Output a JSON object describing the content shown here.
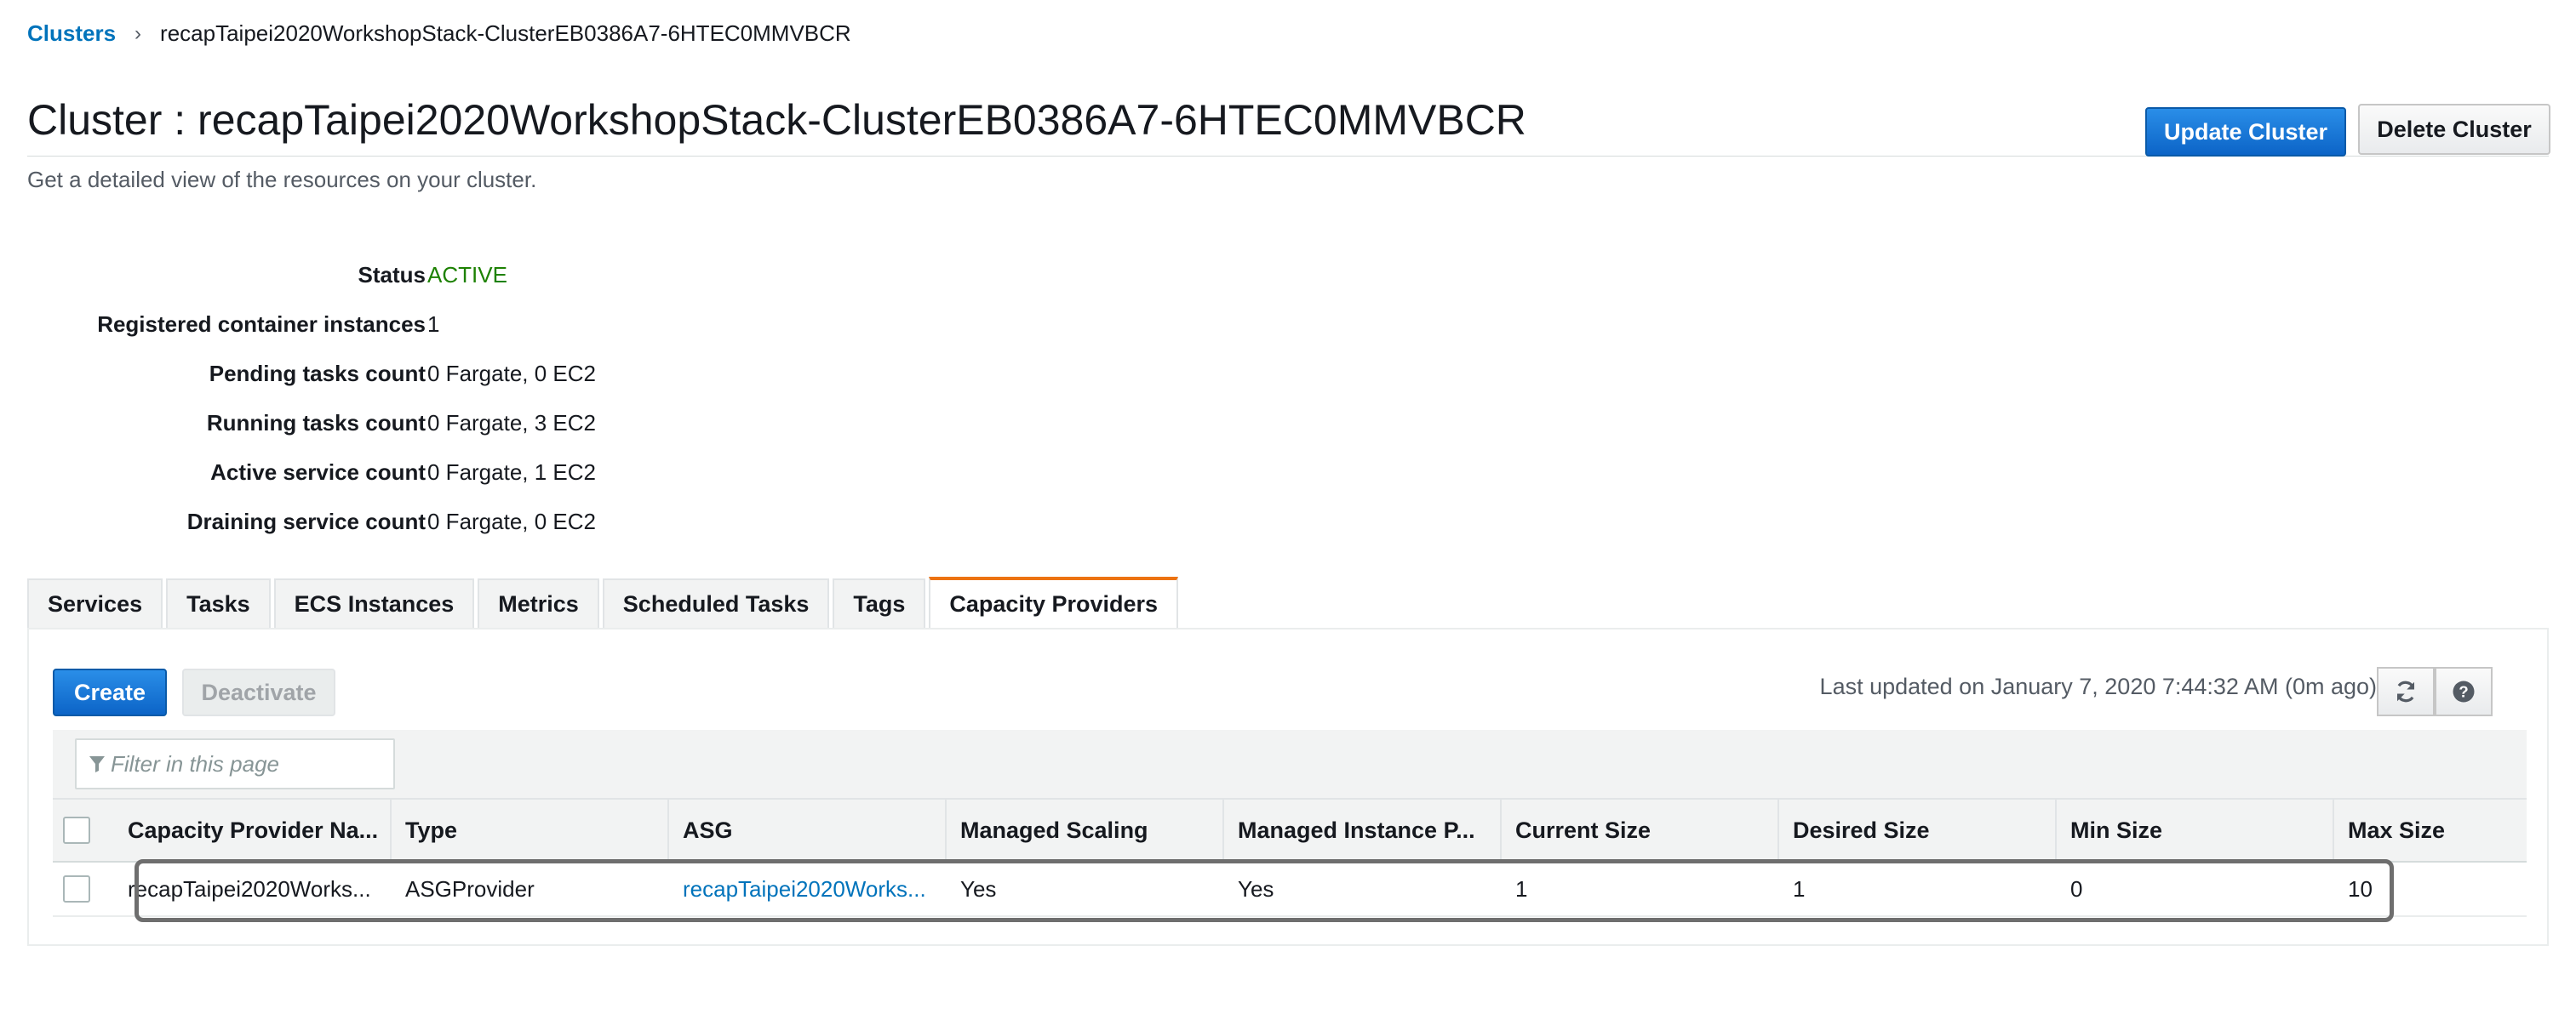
{
  "breadcrumb": {
    "parent": "Clusters",
    "current": "recapTaipei2020WorkshopStack-ClusterEB0386A7-6HTEC0MMVBCR"
  },
  "header": {
    "title": "Cluster : recapTaipei2020WorkshopStack-ClusterEB0386A7-6HTEC0MMVBCR",
    "subtitle": "Get a detailed view of the resources on your cluster.",
    "update_label": "Update Cluster",
    "delete_label": "Delete Cluster"
  },
  "details": [
    {
      "label": "Status",
      "value": "ACTIVE"
    },
    {
      "label": "Registered container instances",
      "value": "1"
    },
    {
      "label": "Pending tasks count",
      "value": "0 Fargate, 0 EC2"
    },
    {
      "label": "Running tasks count",
      "value": "0 Fargate, 3 EC2"
    },
    {
      "label": "Active service count",
      "value": "0 Fargate, 1 EC2"
    },
    {
      "label": "Draining service count",
      "value": "0 Fargate, 0 EC2"
    }
  ],
  "tabs": [
    "Services",
    "Tasks",
    "ECS Instances",
    "Metrics",
    "Scheduled Tasks",
    "Tags",
    "Capacity Providers"
  ],
  "active_tab": "Capacity Providers",
  "toolbar": {
    "create_label": "Create",
    "deactivate_label": "Deactivate",
    "last_updated": "Last updated on January 7, 2020 7:44:32 AM (0m ago)",
    "refresh_icon": "refresh-icon",
    "help_icon": "help-icon"
  },
  "filter": {
    "placeholder": "Filter in this page",
    "icon": "filter-icon"
  },
  "table": {
    "columns": [
      "Capacity Provider Na...",
      "Type",
      "ASG",
      "Managed Scaling",
      "Managed Instance P...",
      "Current Size",
      "Desired Size",
      "Min Size",
      "Max Size"
    ],
    "rows": [
      [
        "recapTaipei2020Works...",
        "ASGProvider",
        "recapTaipei2020Works...",
        "Yes",
        "Yes",
        "1",
        "1",
        "0",
        "10"
      ]
    ]
  },
  "colors": {
    "link": "#0073bb",
    "status_active": "#1d8102",
    "primary_button": "#0c64c7",
    "active_tab_accent": "#ec7211"
  }
}
